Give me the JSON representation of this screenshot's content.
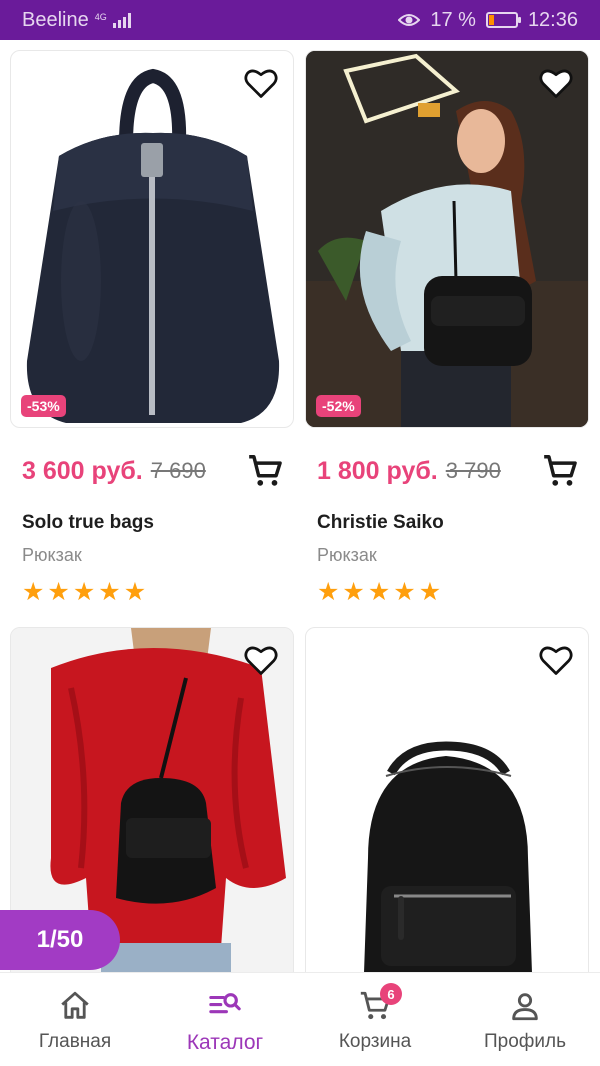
{
  "status_bar": {
    "carrier": "Beeline",
    "network": "4G",
    "battery_percent": "17 %",
    "time": "12:36",
    "battery_level": 0.17
  },
  "products": [
    {
      "brand": "Solo true bags",
      "type": "Рюкзак",
      "price": "3 600 руб.",
      "old_price": "7 690",
      "discount": "-53%",
      "rating": 5
    },
    {
      "brand": "Christie Saiko",
      "type": "Рюкзак",
      "price": "1 800 руб.",
      "old_price": "3 790",
      "discount": "-52%",
      "rating": 5
    }
  ],
  "page_indicator": "1/50",
  "nav": {
    "home": "Главная",
    "catalog": "Каталог",
    "cart": "Корзина",
    "cart_badge": "6",
    "profile": "Профиль"
  },
  "colors": {
    "brand": "#6a1b9a",
    "accent": "#9c37b8",
    "price": "#e8437a",
    "stars": "#ff9f0d"
  }
}
